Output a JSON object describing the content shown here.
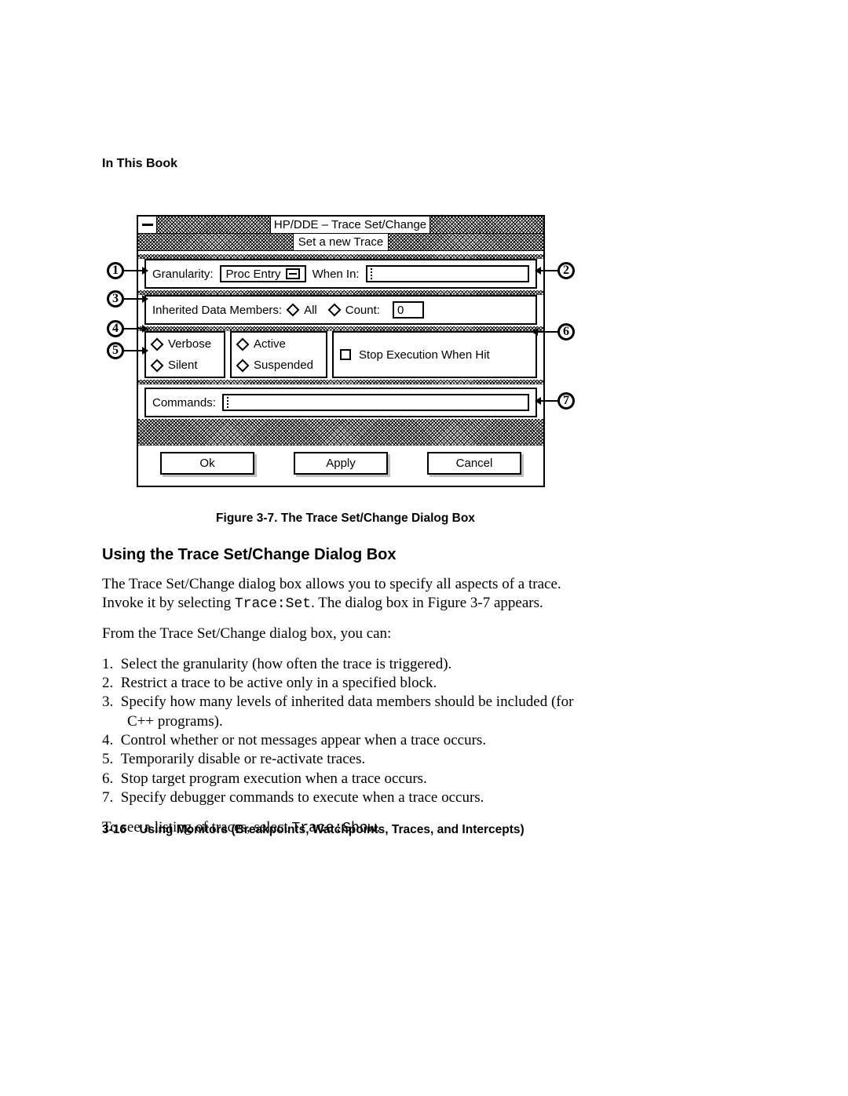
{
  "header": {
    "in_this_book": "In This Book"
  },
  "dialog": {
    "title": "HP/DDE – Trace Set/Change",
    "subtitle": "Set a new Trace",
    "granularity_label": "Granularity:",
    "granularity_value": "Proc Entry",
    "when_in_label": "When In:",
    "when_in_value": "",
    "inherited_label": "Inherited Data Members:",
    "inherited_all": "All",
    "inherited_count_label": "Count:",
    "inherited_count_value": "0",
    "verbose": "Verbose",
    "silent": "Silent",
    "active": "Active",
    "suspended": "Suspended",
    "stop_when_hit": "Stop Execution When Hit",
    "commands_label": "Commands:",
    "commands_value": "",
    "ok": "Ok",
    "apply": "Apply",
    "cancel": "Cancel"
  },
  "callouts": {
    "c1": "1",
    "c2": "2",
    "c3": "3",
    "c4": "4",
    "c5": "5",
    "c6": "6",
    "c7": "7"
  },
  "figure_caption": "Figure 3-7. The Trace Set/Change Dialog Box",
  "section_heading": "Using the Trace Set/Change Dialog Box",
  "para1_a": "The Trace Set/Change dialog box allows you to specify all aspects of a trace. Invoke it by selecting ",
  "para1_code": "Trace:Set",
  "para1_b": ". The dialog box in Figure 3-7 appears.",
  "para2": "From the Trace Set/Change dialog box, you can:",
  "list": {
    "i1": "Select the granularity (how often the trace is triggered).",
    "i2": "Restrict a trace to be active only in a specified block.",
    "i3": "Specify how many levels of inherited data members should be included (for C++ programs).",
    "i4": "Control whether or not messages appear when a trace occurs.",
    "i5": "Temporarily disable or re-activate traces.",
    "i6": "Stop target program execution when a trace occurs.",
    "i7": "Specify debugger commands to execute when a trace occurs."
  },
  "para3_a": "To see a listing of traces, select ",
  "para3_code": "Trace:Show",
  "para3_b": ".",
  "footer": {
    "page": "3-16",
    "title": "Using Monitors (Breakpoints, Watchpoints, Traces, and Intercepts)"
  }
}
